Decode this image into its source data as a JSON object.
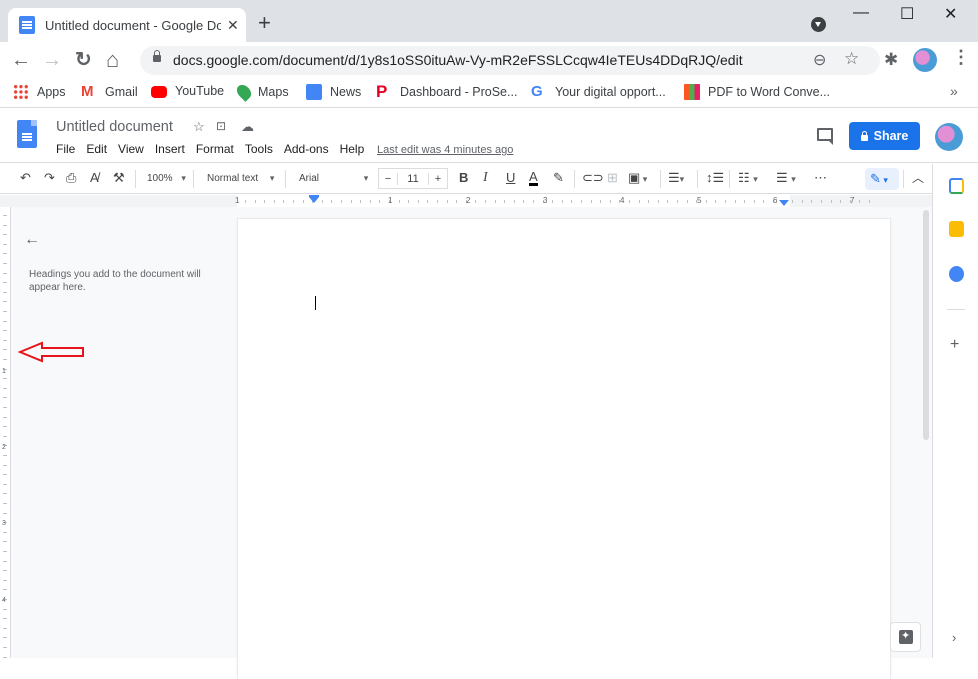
{
  "browser": {
    "tab": {
      "title": "Untitled document - Google Doc",
      "close_icon": "close-icon"
    },
    "new_tab_label": "+",
    "window_controls": {
      "minimize": "—",
      "maximize": "☐",
      "close": "✕"
    },
    "nav": {
      "back": "←",
      "forward": "→",
      "reload": "↻",
      "home": "⌂"
    },
    "address_bar": {
      "url": "docs.google.com/document/d/1y8s1oSS0ituAw-Vy-mR2eFSSLCcqw4IeTEUs4DDqRJQ/edit"
    },
    "bookmarks": [
      {
        "label": "Apps",
        "icon": "apps-grid-icon"
      },
      {
        "label": "Gmail",
        "icon": "gmail-icon"
      },
      {
        "label": "YouTube",
        "icon": "youtube-icon"
      },
      {
        "label": "Maps",
        "icon": "maps-pin-icon"
      },
      {
        "label": "News",
        "icon": "google-news-icon"
      },
      {
        "label": "Dashboard - ProSe...",
        "icon": "pinterest-icon"
      },
      {
        "label": "Your digital opport...",
        "icon": "google-g-icon"
      },
      {
        "label": "PDF to Word Conve...",
        "icon": "pdf-converter-icon"
      }
    ],
    "bookmarks_overflow": "»"
  },
  "docs": {
    "title": "Untitled document",
    "title_icons": [
      "star-icon",
      "move-to-folder-icon",
      "cloud-saved-icon"
    ],
    "menu": [
      "File",
      "Edit",
      "View",
      "Insert",
      "Format",
      "Tools",
      "Add-ons",
      "Help"
    ],
    "last_edit": "Last edit was 4 minutes ago",
    "share_label": "Share",
    "accent": "#1a73e8"
  },
  "toolbar": {
    "zoom": "100%",
    "style": "Normal text",
    "font": "Arial",
    "font_size": "11",
    "decrease": "−",
    "increase": "+",
    "bold": "B",
    "italic": "I",
    "underline": "U",
    "text_color": "A",
    "more": "⋯"
  },
  "ruler": {
    "labels": [
      "1",
      "1",
      "2",
      "3",
      "4",
      "5",
      "6",
      "7"
    ]
  },
  "vertical_ruler": {
    "labels": [
      "1",
      "1",
      "2",
      "3",
      "4"
    ]
  },
  "outline": {
    "hint": "Headings you add to the document will appear here."
  },
  "side_panel": {
    "apps": [
      "calendar-icon",
      "keep-icon",
      "tasks-icon"
    ],
    "add": "+",
    "expand": "›"
  }
}
